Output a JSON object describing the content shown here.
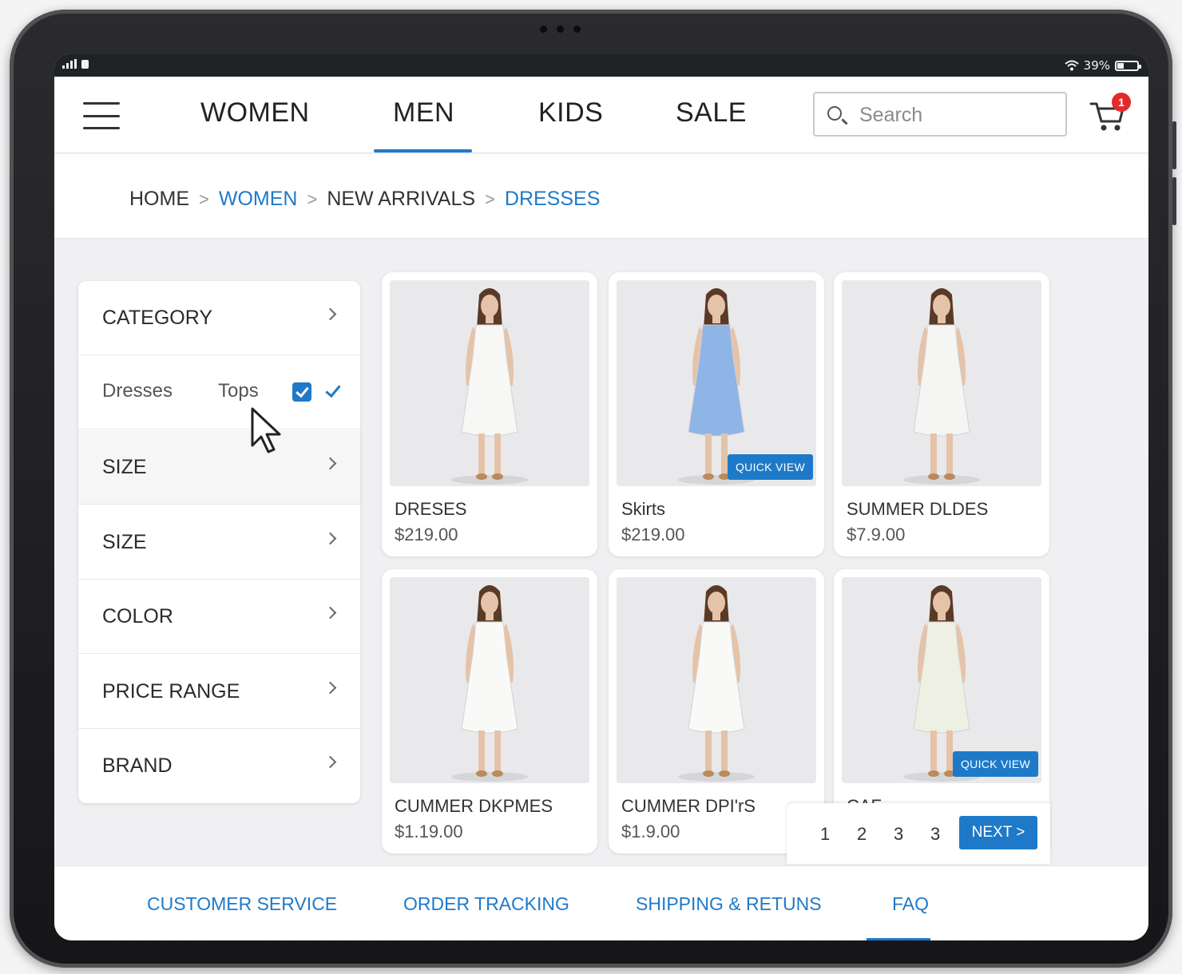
{
  "status_bar": {
    "battery": "39%"
  },
  "nav": {
    "tabs": [
      {
        "label": "WOMEN"
      },
      {
        "label": "MEN",
        "active": true
      },
      {
        "label": "KIDS"
      },
      {
        "label": "SALE"
      }
    ]
  },
  "search": {
    "placeholder": "Search",
    "value": ""
  },
  "cart": {
    "badge": "1"
  },
  "breadcrumb": [
    "HOME",
    "WOMEN",
    "NEW ARRIVALS",
    "DRESSES"
  ],
  "filters": {
    "category_label": "CATEGORY",
    "options": [
      "Dresses",
      "Tops"
    ],
    "rows": [
      "SIZE",
      "SIZE",
      "COLOR",
      "PRICE RANGE",
      "BRAND"
    ]
  },
  "products": [
    {
      "name": "DRESES",
      "price": "$219.00",
      "dress_color": "#f7f7f5"
    },
    {
      "name": "Skirts",
      "price": "$219.00",
      "dress_color": "#8fb4e6",
      "quick_view": "QUICK VIEW"
    },
    {
      "name": "SUMMER DLDES",
      "price": "$7.9.00",
      "dress_color": "#f5f5f3"
    },
    {
      "name": "CUMMER DKPMES",
      "price": "$1.19.00",
      "dress_color": "#f9f9f8"
    },
    {
      "name": "CUMMER DPI'rS",
      "price": "$1.9.00",
      "dress_color": "#f9f9f8"
    },
    {
      "name": "CAF",
      "price": "",
      "dress_color": "#eef0e4",
      "quick_view": "QUICK VIEW"
    }
  ],
  "pagination": {
    "pages": [
      "1",
      "2",
      "3",
      "3"
    ],
    "next_label": "NEXT >"
  },
  "footer": {
    "links": [
      "CUSTOMER SERVICE",
      "ORDER TRACKING",
      "SHIPPING & RETUNS",
      "FAQ"
    ]
  },
  "colors": {
    "accent": "#1e7ac9",
    "badge": "#e02b2b"
  }
}
